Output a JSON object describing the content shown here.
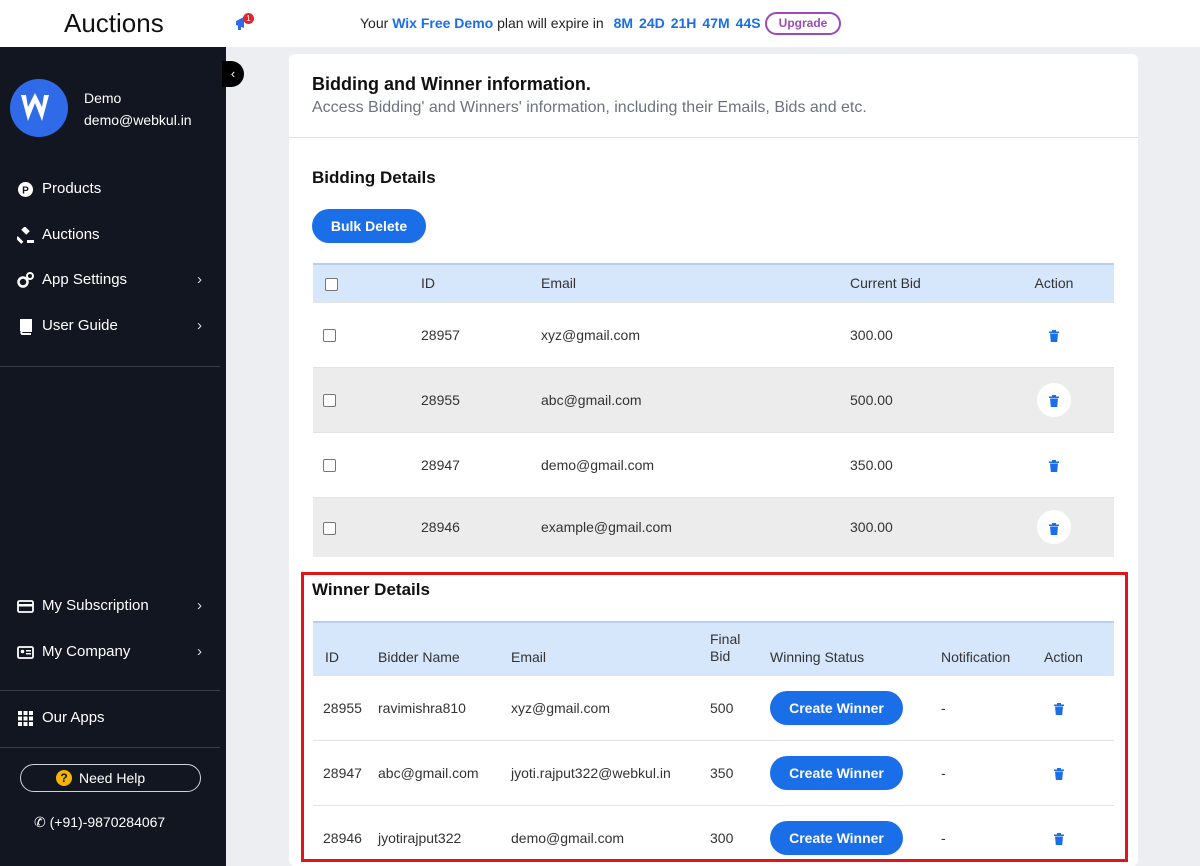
{
  "header": {
    "app_title": "Auctions",
    "notification_count": "1",
    "plan_prefix": "Your",
    "plan_name": "Wix Free Demo",
    "plan_middle": "plan will expire in",
    "countdown": [
      "8M",
      "24D",
      "21H",
      "47M",
      "44S"
    ],
    "upgrade_label": "Upgrade"
  },
  "sidebar": {
    "user_name": "Demo",
    "user_email": "demo@webkul.in",
    "nav": [
      {
        "label": "Products",
        "icon": "product-icon"
      },
      {
        "label": "Auctions",
        "icon": "gavel-icon"
      },
      {
        "label": "App Settings",
        "icon": "gears-icon"
      },
      {
        "label": "User Guide",
        "icon": "book-icon"
      }
    ],
    "bottom_nav": [
      {
        "label": "My Subscription",
        "icon": "credit-card-icon"
      },
      {
        "label": "My Company",
        "icon": "id-card-icon"
      },
      {
        "label": "Our Apps",
        "icon": "grid-icon"
      }
    ],
    "help_label": "Need Help",
    "phone": "(+91)-9870284067"
  },
  "main": {
    "title": "Bidding and Winner information.",
    "subtitle": "Access Bidding' and Winners' information, including their Emails, Bids and etc.",
    "bidding": {
      "title": "Bidding Details",
      "bulk_delete_label": "Bulk Delete",
      "columns": [
        "ID",
        "Email",
        "Current Bid",
        "Action"
      ],
      "rows": [
        {
          "id": "28957",
          "email": "xyz@gmail.com",
          "bid": "300.00"
        },
        {
          "id": "28955",
          "email": "abc@gmail.com",
          "bid": "500.00"
        },
        {
          "id": "28947",
          "email": "demo@gmail.com",
          "bid": "350.00"
        },
        {
          "id": "28946",
          "email": "example@gmail.com",
          "bid": "300.00"
        }
      ]
    },
    "winners": {
      "title": "Winner Details",
      "columns": [
        "ID",
        "Bidder Name",
        "Email",
        "Final Bid",
        "Winning Status",
        "Notification",
        "Action"
      ],
      "rows": [
        {
          "id": "28955",
          "bidder": "ravimishra810",
          "email": "xyz@gmail.com",
          "final_bid": "500",
          "status_label": "Create Winner",
          "notification": "-"
        },
        {
          "id": "28947",
          "bidder": "abc@gmail.com",
          "email": "jyoti.rajput322@webkul.in",
          "final_bid": "350",
          "status_label": "Create Winner",
          "notification": "-"
        },
        {
          "id": "28946",
          "bidder": "jyotirajput322",
          "email": "demo@gmail.com",
          "final_bid": "300",
          "status_label": "Create Winner",
          "notification": "-"
        }
      ]
    }
  },
  "colors": {
    "accent": "#1a6fe8",
    "sidebar_bg": "#121620",
    "highlight": "#e0151a",
    "upgrade": "#9b4bb8"
  }
}
